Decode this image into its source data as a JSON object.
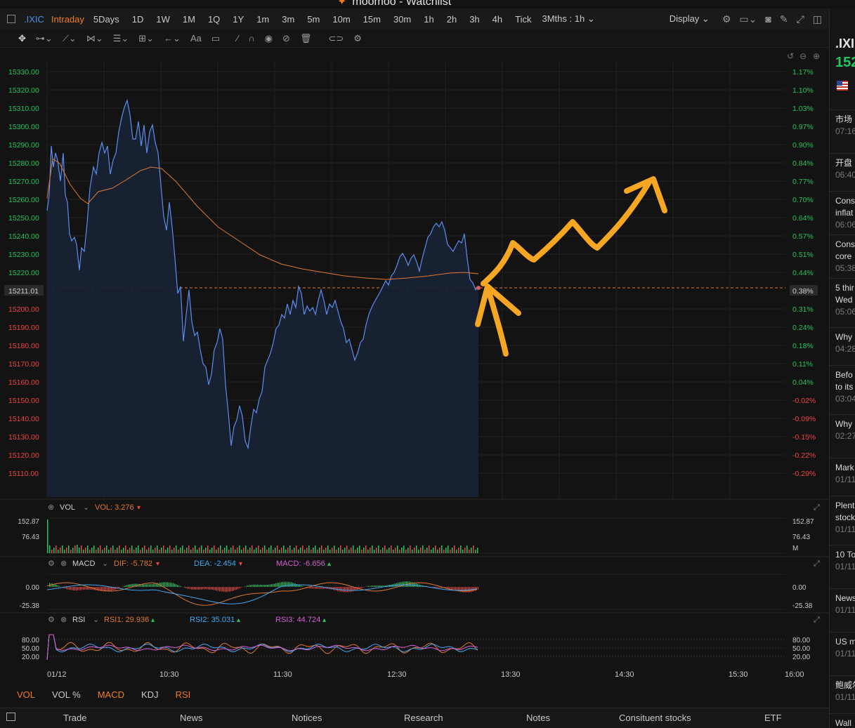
{
  "window": {
    "title": "moomoo - Watchlist"
  },
  "toolbar": {
    "symbol": ".IXIC",
    "periods": [
      "Intraday",
      "5Days",
      "1D",
      "1W",
      "1M",
      "1Q",
      "1Y",
      "1m",
      "3m",
      "5m",
      "10m",
      "15m",
      "30m",
      "1h",
      "2h",
      "3h",
      "4h",
      "Tick"
    ],
    "active_period": "Intraday",
    "range_select": "3Mths : 1h",
    "display_label": "Display"
  },
  "side_panel": {
    "symbol": ".IXI",
    "price": "152",
    "news": [
      {
        "headline": "市场",
        "time": "07:16"
      },
      {
        "headline": "开盘",
        "time": "06:40"
      },
      {
        "headline": "Cons",
        "line2": "inflat",
        "time": "06:06"
      },
      {
        "headline": "Cons",
        "line2": "core",
        "time": "05:38"
      },
      {
        "headline": "5 thir",
        "line2": "Wed",
        "time": "05:06"
      },
      {
        "headline": "Why",
        "time": "04:28"
      },
      {
        "headline": "Befo",
        "line2": "to its",
        "time": "03:04"
      },
      {
        "headline": "Why",
        "time": "02:27"
      },
      {
        "headline": "Mark",
        "time": "01/11"
      },
      {
        "headline": "Plent",
        "line2": "stock",
        "time": "01/11"
      },
      {
        "headline": "10 To",
        "time": "01/11"
      },
      {
        "headline": "News",
        "time": "01/11"
      },
      {
        "headline": "US m",
        "time": "01/11"
      },
      {
        "headline": "鲍威尔",
        "time": "01/11"
      },
      {
        "headline": "Wall",
        "time": ""
      }
    ]
  },
  "main_chart": {
    "price_ticks": [
      "15330.00",
      "15320.00",
      "15310.00",
      "15300.00",
      "15290.00",
      "15280.00",
      "15270.00",
      "15260.00",
      "15250.00",
      "15240.00",
      "15230.00",
      "15220.00",
      "15211.01",
      "15200.00",
      "15190.00",
      "15180.00",
      "15170.00",
      "15160.00",
      "15150.00",
      "15140.00",
      "15130.00",
      "15120.00",
      "15110.00"
    ],
    "pct_ticks": [
      "1.17%",
      "1.10%",
      "1.03%",
      "0.97%",
      "0.90%",
      "0.84%",
      "0.77%",
      "0.70%",
      "0.64%",
      "0.57%",
      "0.51%",
      "0.44%",
      "0.38%",
      "0.31%",
      "0.24%",
      "0.18%",
      "0.11%",
      "0.04%",
      "-0.02%",
      "-0.09%",
      "-0.15%",
      "-0.22%",
      "-0.29%"
    ],
    "prev_close_label": "15211.01",
    "prev_close_pct": "0.38%",
    "colors": {
      "price_line": "#5b8def",
      "avg_line": "#e0782f",
      "up": "#22c55e",
      "down": "#ef4444",
      "annotation": "#f5a623"
    }
  },
  "vol_panel": {
    "name": "VOL",
    "value_label": "VOL: 3.276",
    "ticks": [
      "152.87",
      "76.43"
    ],
    "unit": "M"
  },
  "macd_panel": {
    "name": "MACD",
    "dif": "DIF: -5.782",
    "dea": "DEA: -2.454",
    "macd": "MACD: -6.656",
    "ticks": [
      "0.00",
      "-25.38"
    ]
  },
  "rsi_panel": {
    "name": "RSI",
    "rsi1": "RSI1: 29.936",
    "rsi2": "RSI2: 35.031",
    "rsi3": "RSI3: 44.724",
    "ticks": [
      "80.00",
      "50.00",
      "20.00"
    ]
  },
  "time_axis": [
    "01/12",
    "10:30",
    "11:30",
    "12:30",
    "13:30",
    "14:30",
    "15:30",
    "16:00"
  ],
  "indicator_tabs": [
    "VOL",
    "VOL %",
    "MACD",
    "KDJ",
    "RSI"
  ],
  "indicator_tabs_active": [
    "VOL",
    "MACD",
    "RSI"
  ],
  "bottom_nav": [
    "Trade",
    "News",
    "Notices",
    "Research",
    "Notes",
    "Consituent stocks",
    "ETF"
  ]
}
